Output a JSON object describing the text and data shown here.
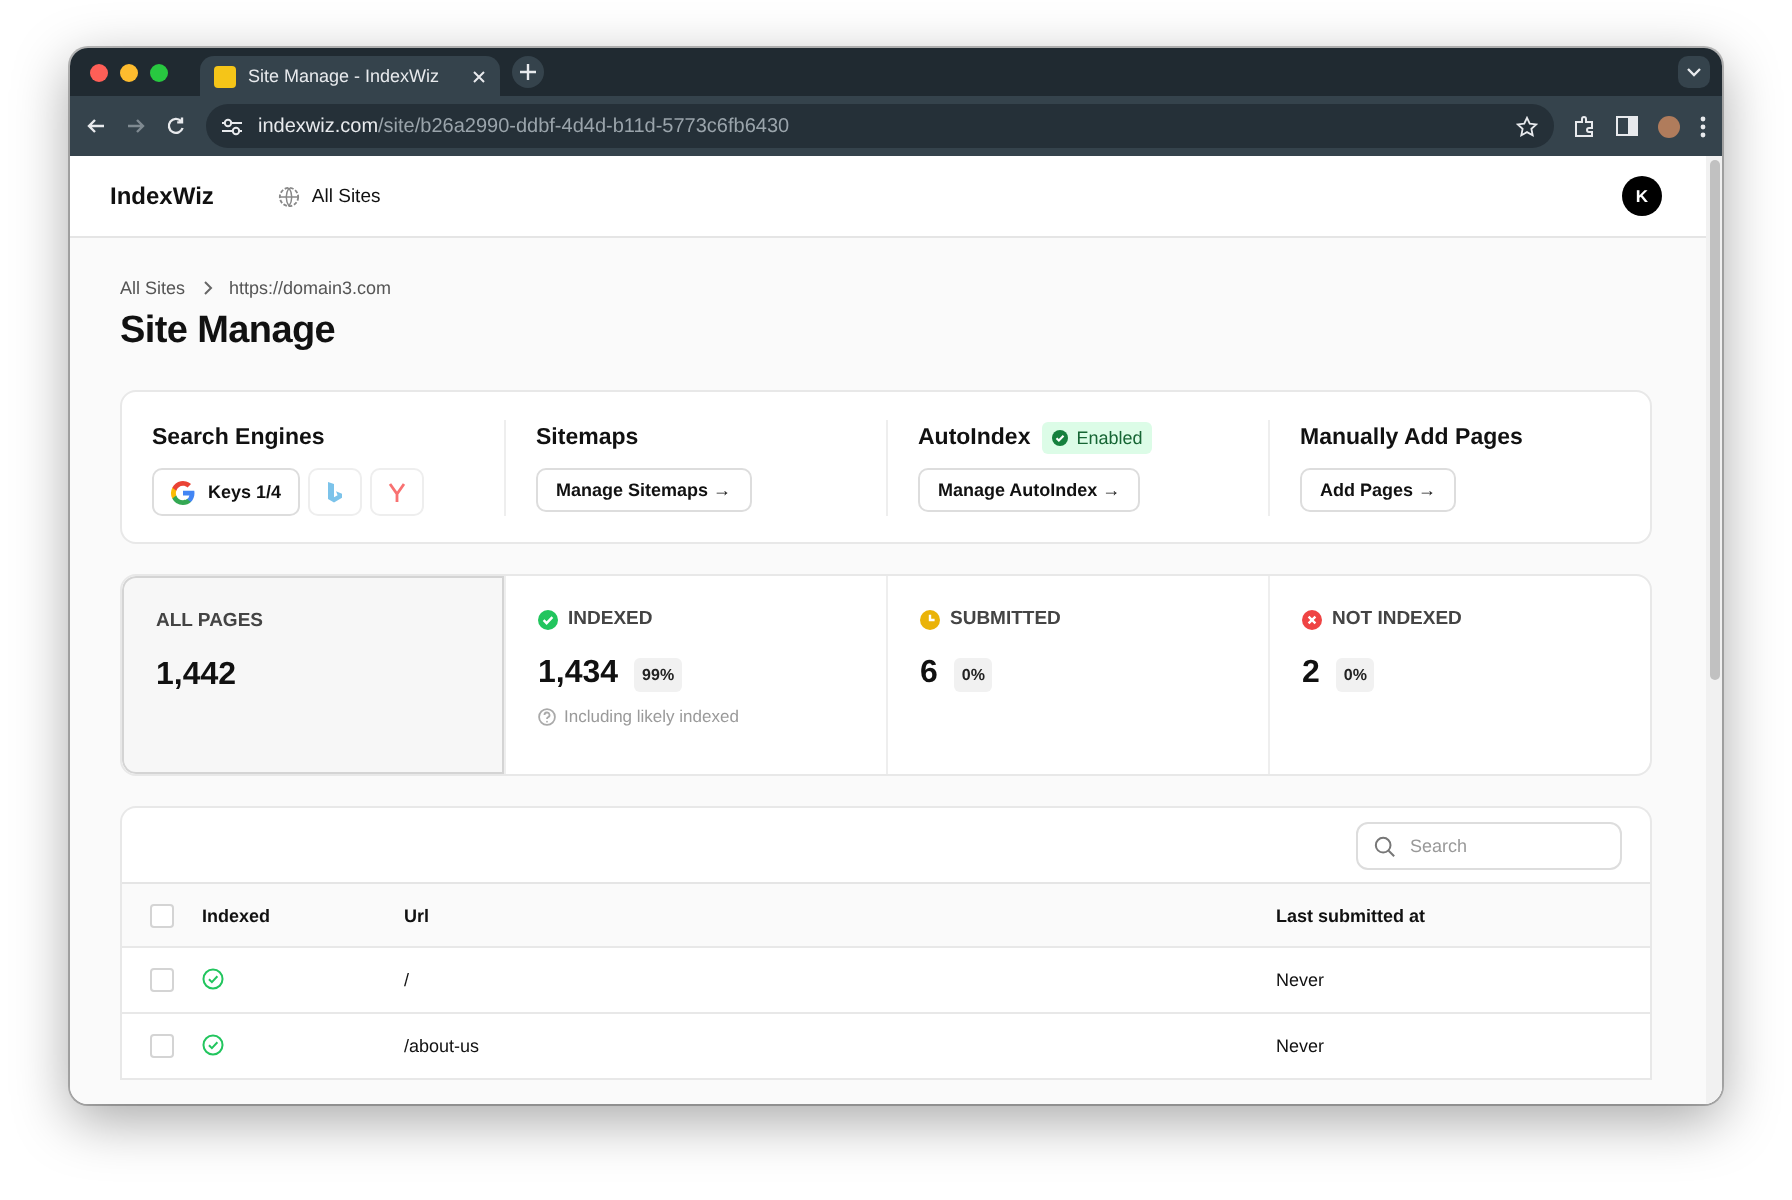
{
  "browser": {
    "tab_title": "Site Manage - IndexWiz",
    "url_domain": "indexwiz.com",
    "url_path": "/site/b26a2990-ddbf-4d4d-b11d-5773c6fb6430"
  },
  "nav": {
    "logo": "IndexWiz",
    "link": "All Sites",
    "avatar": "K"
  },
  "breadcrumb": [
    "All Sites",
    "https://domain3.com"
  ],
  "title": "Site Manage",
  "sections": [
    {
      "kind": "engines",
      "title": "Search Engines",
      "engines": [
        {
          "kind": "google",
          "label": "Keys 1/4"
        },
        {
          "kind": "bing"
        },
        {
          "kind": "yandex"
        }
      ]
    },
    {
      "kind": "action",
      "title": "Sitemaps",
      "button": "Manage Sitemaps →"
    },
    {
      "kind": "action",
      "title": "AutoIndex",
      "badge": "Enabled",
      "button": "Manage AutoIndex →"
    },
    {
      "kind": "action",
      "title": "Manually Add Pages",
      "button": "Add Pages →"
    }
  ],
  "stats": [
    {
      "kind": "all",
      "label": "ALL PAGES",
      "value": "1,442",
      "selected": true
    },
    {
      "kind": "indexed",
      "label": "INDEXED",
      "value": "1,434",
      "percent": "99%",
      "note": "Including likely indexed",
      "selected": false
    },
    {
      "kind": "submitted",
      "label": "SUBMITTED",
      "value": "6",
      "percent": "0%",
      "selected": false
    },
    {
      "kind": "not_indexed",
      "label": "NOT INDEXED",
      "value": "2",
      "percent": "0%",
      "selected": false
    }
  ],
  "table": {
    "search_placeholder": "Search",
    "select_all_checked": false,
    "columns": [
      "Indexed",
      "Url",
      "Last submitted at"
    ],
    "rows": [
      {
        "checked": false,
        "indexed": true,
        "url": "/",
        "last_submitted": "Never"
      },
      {
        "checked": false,
        "indexed": true,
        "url": "/about-us",
        "last_submitted": "Never"
      }
    ]
  }
}
